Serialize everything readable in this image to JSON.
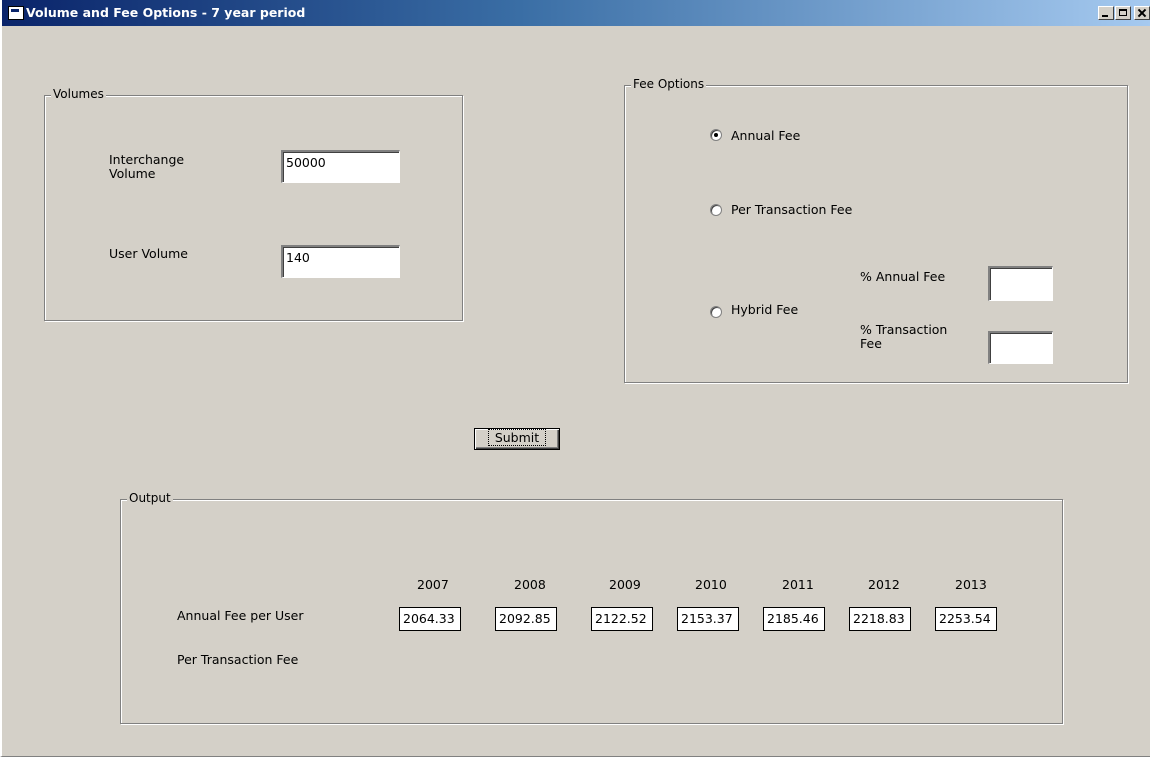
{
  "window": {
    "title": "Volume and Fee Options - 7 year period"
  },
  "volumes": {
    "group_label": "Volumes",
    "interchange_label_line1": "Interchange",
    "interchange_label_line2": "Volume",
    "interchange_value": "50000",
    "user_label": "User Volume",
    "user_value": "140"
  },
  "fee_options": {
    "group_label": "Fee Options",
    "annual_label": "Annual Fee",
    "per_transaction_label": "Per Transaction Fee",
    "hybrid_label": "Hybrid Fee",
    "pct_annual_label": "% Annual Fee",
    "pct_transaction_label_line1": "% Transaction",
    "pct_transaction_label_line2": "Fee",
    "pct_annual_value": "",
    "pct_transaction_value": "",
    "selected": "annual"
  },
  "submit_label": "Submit",
  "output": {
    "group_label": "Output",
    "years": [
      "2007",
      "2008",
      "2009",
      "2010",
      "2011",
      "2012",
      "2013"
    ],
    "row1_label": "Annual Fee per User",
    "row2_label": "Per Transaction Fee",
    "annual_fee_values": [
      "2064.33",
      "2092.85",
      "2122.52",
      "2153.37",
      "2185.46",
      "2218.83",
      "2253.54"
    ]
  }
}
